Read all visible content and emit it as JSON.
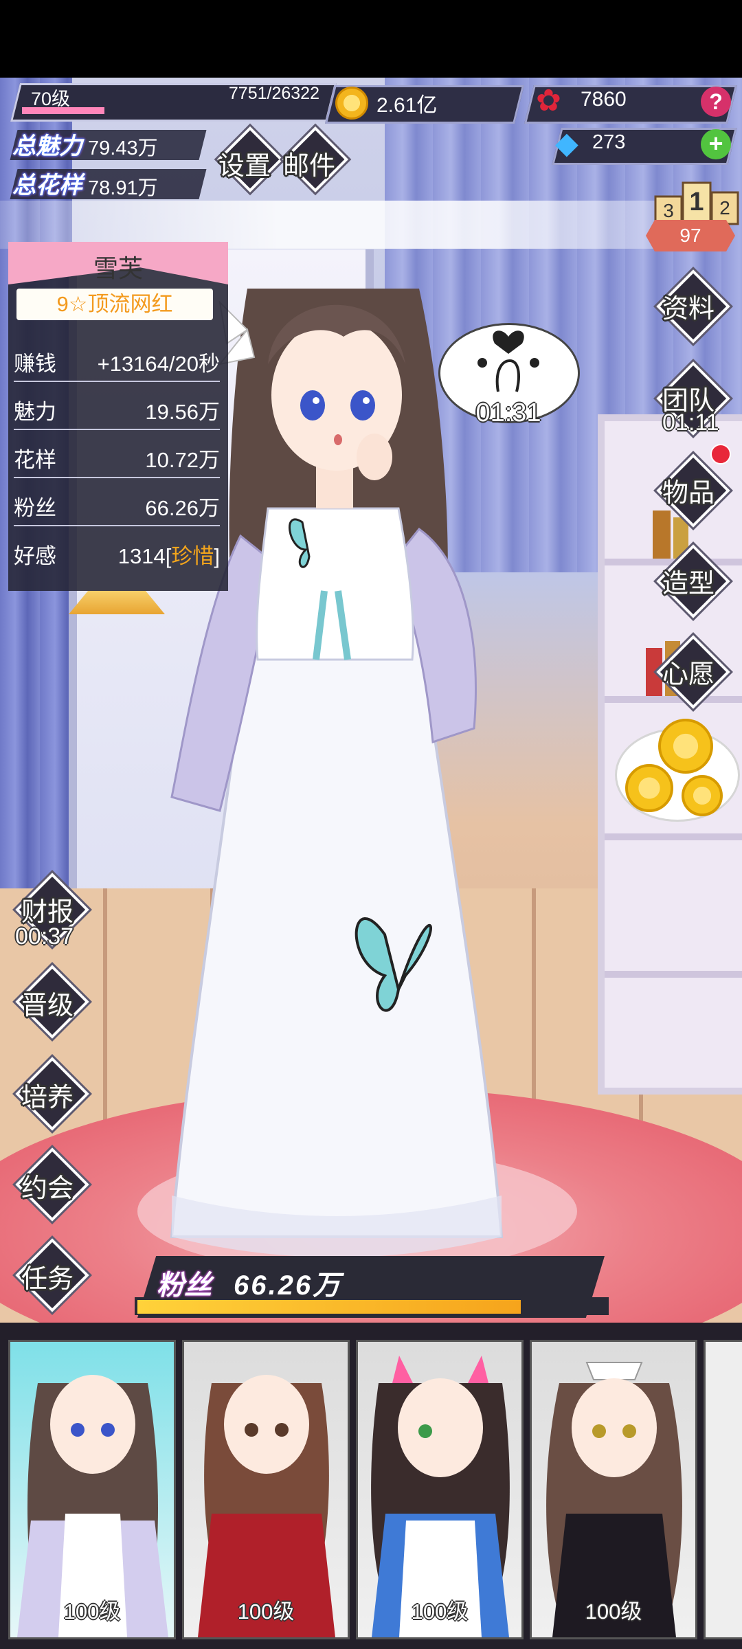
{
  "player": {
    "level": "70级",
    "exp": "7751/26322",
    "exp_fraction": 0.28
  },
  "currency": {
    "coins": "2.61亿",
    "roses": "7860",
    "gems": "273"
  },
  "totals": {
    "charm_label": "总魅力",
    "charm_value": "79.43万",
    "style_label": "总花样",
    "style_value": "78.91万"
  },
  "top_menu": {
    "settings": "设置",
    "mail": "邮件"
  },
  "rank": {
    "first": "1",
    "second": "2",
    "third": "3",
    "score": "97"
  },
  "girl": {
    "name": "雪芙",
    "title": "9☆顶流网红",
    "stats": [
      {
        "label": "赚钱",
        "value": "+13164/20秒"
      },
      {
        "label": "魅力",
        "value": "19.56万"
      },
      {
        "label": "花样",
        "value": "10.72万"
      },
      {
        "label": "粉丝",
        "value": "66.26万"
      }
    ],
    "affection_label": "好感",
    "affection_value": "1314",
    "affection_open": "[",
    "affection_tag": "珍惜",
    "affection_close": "]"
  },
  "bubble_timer": "01:31",
  "right_menu": {
    "profile": "资料",
    "team": "团队",
    "team_timer": "01:11",
    "items": "物品",
    "styling": "造型",
    "wish": "心愿"
  },
  "left_menu": {
    "report": "财报",
    "report_timer": "00:37",
    "promote": "晋级",
    "train": "培养",
    "date": "约会",
    "task": "任务"
  },
  "fans_bar": {
    "label": "粉丝",
    "value": "66.26万",
    "fraction": 0.82
  },
  "roster": [
    {
      "level": "100级"
    },
    {
      "level": "100级"
    },
    {
      "level": "100级"
    },
    {
      "level": "100级"
    }
  ],
  "colors": {
    "accent_pink": "#f6a8c6",
    "gold": "#f3a51c",
    "panel": "#242434"
  }
}
